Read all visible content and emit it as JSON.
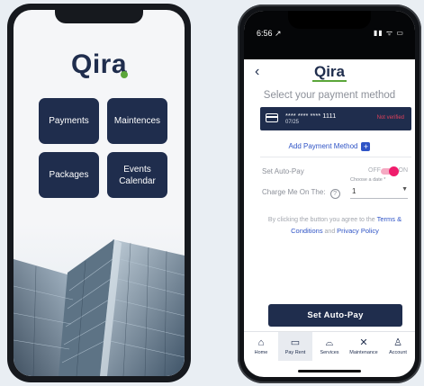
{
  "left_phone": {
    "logo_text": "Qira",
    "tiles": [
      {
        "label": "Payments"
      },
      {
        "label": "Maintences"
      },
      {
        "label": "Packages"
      },
      {
        "label": "Events Calendar"
      }
    ]
  },
  "right_phone": {
    "status": {
      "time": "6:56 ↗",
      "icons": "▮▮ ᯤ ▭"
    },
    "nav": {
      "back_icon": "‹",
      "logo_text": "Qira"
    },
    "title": "Select your payment method",
    "card": {
      "number": "**** **** **** 1111",
      "expiry": "07/25",
      "status": "Not verified"
    },
    "add_method_label": "Add Payment Method",
    "add_method_icon": "+",
    "autopay": {
      "label": "Set Auto-Pay",
      "off_text": "OFF",
      "on_text": "ON",
      "state": "on",
      "accent": "#ef1d6c"
    },
    "charge": {
      "label": "Charge Me On The:",
      "help_icon": "?",
      "date_caption": "Choose a date *",
      "date_value": "1"
    },
    "consent": {
      "prefix": "By clicking the button you agree to the",
      "terms_link": "Terms & Conditions",
      "and_text": "and",
      "privacy_link": "Privacy Policy"
    },
    "set_button_label": "Set Auto-Pay",
    "bottom_nav": [
      {
        "label": "Home",
        "icon": "⌂"
      },
      {
        "label": "Pay Rent",
        "icon": "▭"
      },
      {
        "label": "Services",
        "icon": "⌓"
      },
      {
        "label": "Maintenance",
        "icon": "✕"
      },
      {
        "label": "Account",
        "icon": "♙"
      }
    ],
    "active_nav": "Pay Rent"
  },
  "colors": {
    "navy": "#1f2d4d",
    "green": "#5ba63a",
    "link_blue": "#2f54c6",
    "pink": "#ef1d6c"
  }
}
